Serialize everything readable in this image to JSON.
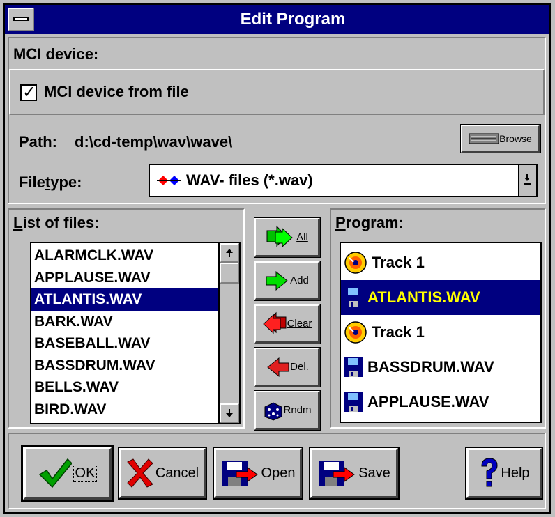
{
  "window": {
    "title": "Edit Program"
  },
  "mci": {
    "group_label": "MCI device:",
    "checkbox_label": "MCI device from file",
    "checkbox_checked": true
  },
  "path": {
    "label": "Path:",
    "value": "d:\\cd-temp\\wav\\wave\\",
    "browse_label": "Browse"
  },
  "filetype": {
    "label_pre": "File",
    "label_ul": "t",
    "label_post": "ype:",
    "value": "WAV- files (*.wav)"
  },
  "files": {
    "label_ul": "L",
    "label_rest": "ist of files:",
    "items": [
      "ALARMCLK.WAV",
      "APPLAUSE.WAV",
      "ATLANTIS.WAV",
      "BARK.WAV",
      "BASEBALL.WAV",
      "BASSDRUM.WAV",
      "BELLS.WAV",
      "BIRD.WAV"
    ],
    "selected": "ATLANTIS.WAV"
  },
  "middle_buttons": {
    "all": "All",
    "add": "Add",
    "clear": "Clear",
    "del": "Del.",
    "rndm": "Rndm"
  },
  "program": {
    "label_ul": "P",
    "label_rest": "rogram:",
    "items": [
      {
        "label": "Track 1",
        "icon": "cd-track-icon"
      },
      {
        "label": "ATLANTIS.WAV",
        "icon": "floppy-disk-icon"
      },
      {
        "label": "Track 1",
        "icon": "cd-track-icon"
      },
      {
        "label": "BASSDRUM.WAV",
        "icon": "floppy-disk-icon"
      },
      {
        "label": "APPLAUSE.WAV",
        "icon": "floppy-disk-icon"
      }
    ],
    "selected_index": 1
  },
  "bottom_buttons": {
    "ok": "OK",
    "cancel": "Cancel",
    "open": "Open",
    "save": "Save",
    "help": "Help"
  },
  "colors": {
    "selection": "#000080",
    "program_selected_text": "#ffff00",
    "face": "#c0c0c0"
  }
}
